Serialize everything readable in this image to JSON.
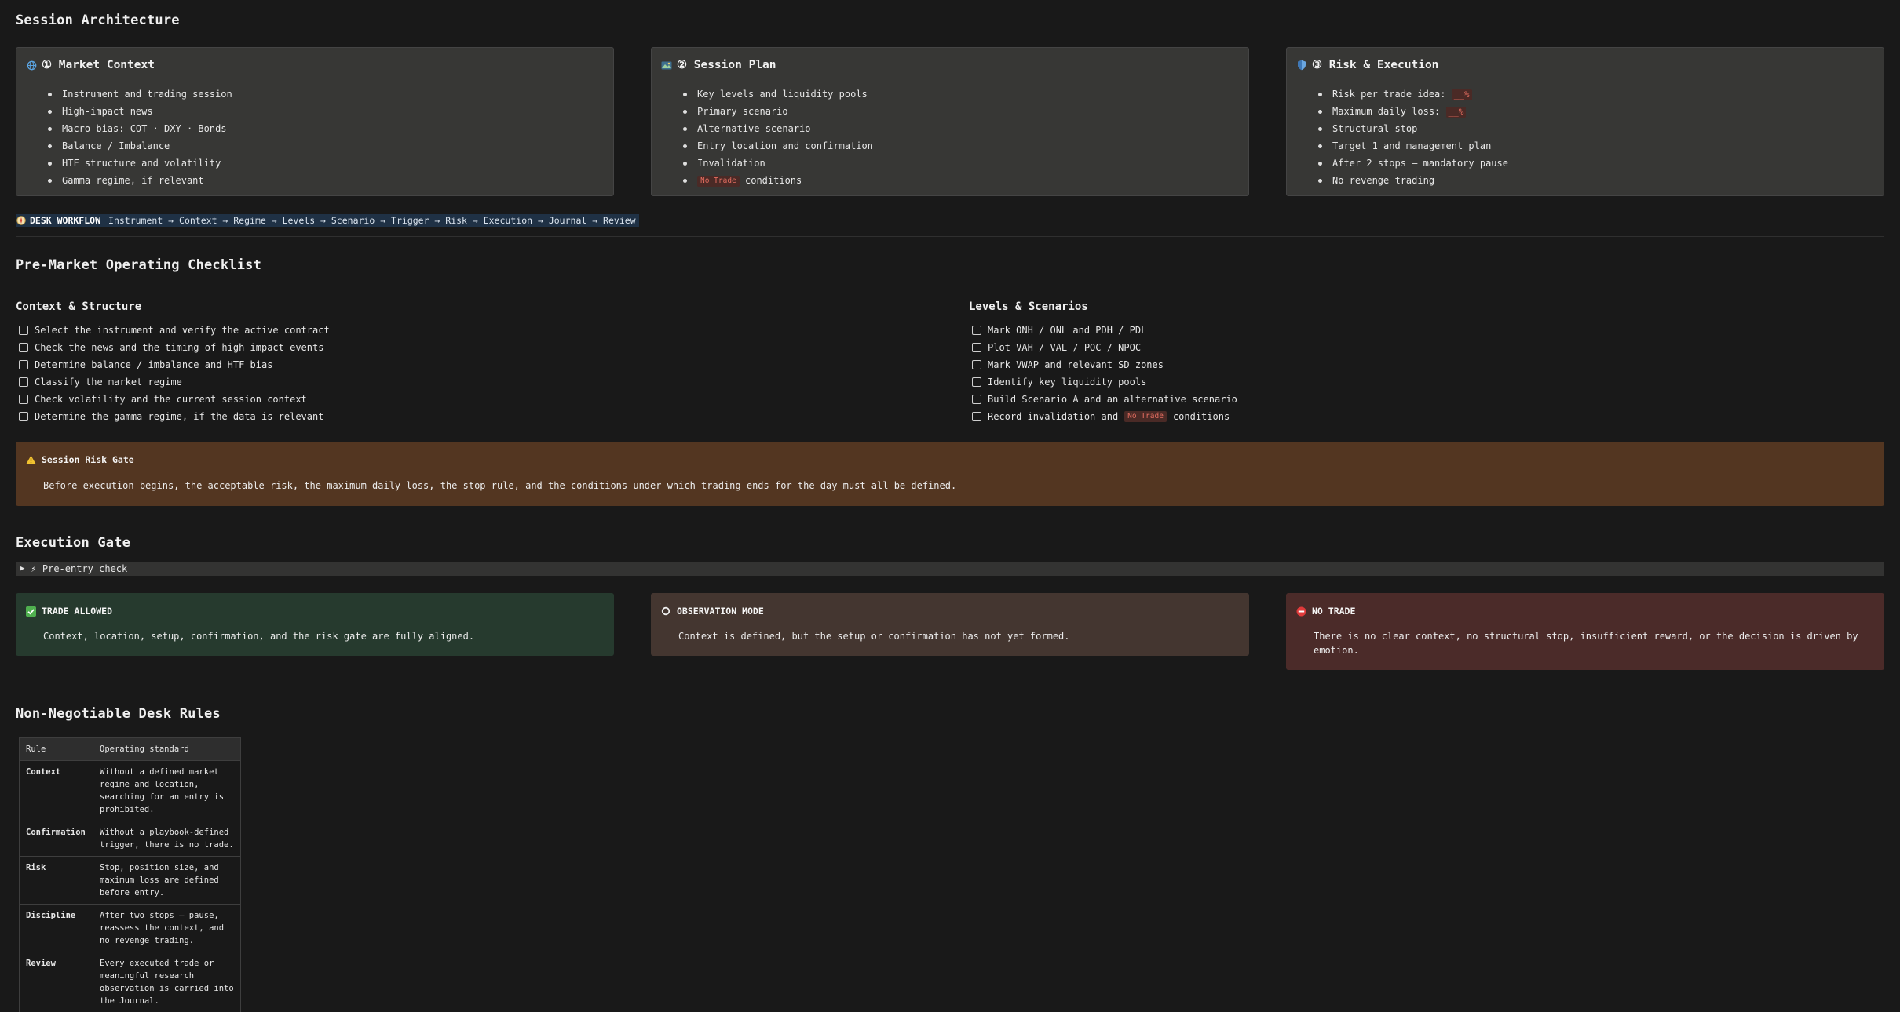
{
  "architecture": {
    "title": "Session Architecture",
    "cards": [
      {
        "icon": "globe-icon",
        "title": "① Market Context",
        "items": [
          "Instrument and trading session",
          "High-impact news",
          "Macro bias: COT · DXY · Bonds",
          "Balance / Imbalance",
          "HTF structure and volatility",
          "Gamma regime, if relevant"
        ]
      },
      {
        "icon": "map-icon",
        "title": "② Session Plan",
        "items": [
          "Key levels and liquidity pools",
          "Primary scenario",
          "Alternative scenario",
          "Entry location and confirmation",
          "Invalidation",
          "conditions"
        ],
        "tag": "No Trade"
      },
      {
        "icon": "shield-icon",
        "title": "③ Risk & Execution",
        "items": [
          "Risk per trade idea:",
          "Maximum daily loss:",
          "Structural stop",
          "Target 1 and management plan",
          "After 2 stops — mandatory pause",
          "No revenge trading"
        ],
        "blank": "__%"
      }
    ]
  },
  "workflow": {
    "icon": "compass-icon",
    "label": "DESK WORKFLOW",
    "steps": "Instrument → Context → Regime → Levels → Scenario → Trigger → Risk → Execution → Journal → Review"
  },
  "checklist": {
    "title": "Pre-Market Operating Checklist",
    "left": {
      "title": "Context & Structure",
      "items": [
        "Select the instrument and verify the active contract",
        "Check the news and the timing of high-impact events",
        "Determine balance / imbalance and HTF bias",
        "Classify the market regime",
        "Check volatility and the current session context",
        "Determine the gamma regime, if the data is relevant"
      ]
    },
    "right": {
      "title": "Levels & Scenarios",
      "items": [
        "Mark ONH / ONL and PDH / PDL",
        "Plot VAH / VAL / POC / NPOC",
        "Mark VWAP and relevant SD zones",
        "Identify key liquidity pools",
        "Build Scenario A and an alternative scenario",
        "Record invalidation and",
        "conditions"
      ],
      "tag": "No Trade"
    },
    "risk_gate": {
      "icon": "warning-icon",
      "title": "Session Risk Gate",
      "body": "Before execution begins, the acceptable risk, the maximum daily loss, the stop rule, and the conditions under which trading ends for the day must all be defined."
    }
  },
  "execution": {
    "title": "Execution Gate",
    "toggle": "⚡ Pre-entry check",
    "gates": [
      {
        "icon": "checkmark-icon",
        "title": "TRADE ALLOWED",
        "body": "Context, location, setup, confirmation, and the risk gate are fully aligned.",
        "color": "#263a2e"
      },
      {
        "icon": "circle-icon",
        "title": "OBSERVATION MODE",
        "body": "Context is defined, but the setup or confirmation has not yet formed.",
        "color": "#443630"
      },
      {
        "icon": "no-entry-icon",
        "title": "NO TRADE",
        "body": "There is no clear context, no structural stop, insufficient reward, or the decision is driven by emotion.",
        "color": "#4b2b29"
      }
    ]
  },
  "rules": {
    "title": "Non-Negotiable Desk Rules",
    "headers": [
      "Rule",
      "Operating standard"
    ],
    "rows": [
      [
        "Context",
        "Without a defined market regime and location, searching for an entry is prohibited."
      ],
      [
        "Confirmation",
        "Without a playbook-defined trigger, there is no trade."
      ],
      [
        "Risk",
        "Stop, position size, and maximum loss are defined before entry."
      ],
      [
        "Discipline",
        "After two stops — pause, reassess the context, and no revenge trading."
      ],
      [
        "Review",
        "Every executed trade or meaningful research observation is carried into the Journal."
      ]
    ]
  },
  "colors": {
    "background": "#191919",
    "card": "#373735",
    "risk_gate": "#533621",
    "workflow_bg": "#1f3145",
    "tag_text": "#e26d60"
  }
}
